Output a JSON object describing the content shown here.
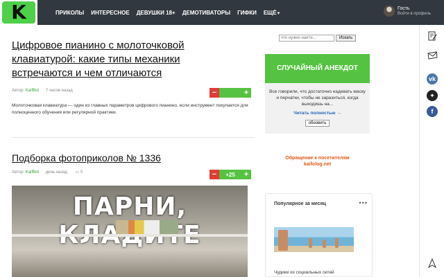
{
  "header": {
    "logo_letter": "K",
    "nav": [
      "ПРИКОЛЫ",
      "ИНТЕРЕСНОЕ",
      "ДЕВУШКИ 18+",
      "ДЕМОТИВАТОРЫ",
      "ГИФКИ",
      "ЕЩЁ"
    ],
    "user_name": "Гость",
    "user_sub": "Войти в профиль"
  },
  "post1": {
    "title": "Цифровое пианино с молоточковой клавиатурой: какие типы механики встречаются и чем отличаются",
    "author_label": "Автор:",
    "author": "KaifBot",
    "time": "7 часов назад",
    "score": "",
    "excerpt": "Молоточковая клавиатура — один из главных параметров цифрового пианино, если инструмент покупается для полноценного обучения или регулярной практики."
  },
  "post2": {
    "title": "Подборка фотоприколов № 1336",
    "author_label": "Автор:",
    "author": "KaifBot",
    "time": "день назад",
    "comments": "0",
    "score": "+25",
    "image_caption": "ПАРНИ, КЛАДИТЕ"
  },
  "sidebar": {
    "search_placeholder": "что нужно найти...",
    "search_button": "Искать",
    "joke_title": "СЛУЧАЙНЫЙ АНЕКДОТ",
    "joke_text": "Все говорили, что достаточно надевать маску и перчатки, чтобы не заразиться, когда выходишь на...",
    "joke_link": "Читать полностью →",
    "refresh": "обновить",
    "notice_line1": "Обращение к посетителям",
    "notice_line2": "kaifolog.net",
    "popular_title": "Популярное за месяц",
    "popular_caption": "Чудики из социальных сетей"
  },
  "rail": {
    "icons": [
      "edit-icon",
      "mail-icon",
      "vk-icon",
      "star-icon",
      "facebook-icon",
      "up-arrow-icon"
    ]
  },
  "colors": {
    "header_bg": "#31383f",
    "accent_green": "#56c242",
    "vote_red": "#e23b36",
    "notice_orange": "#e05a1a",
    "link_blue": "#2463b5"
  }
}
